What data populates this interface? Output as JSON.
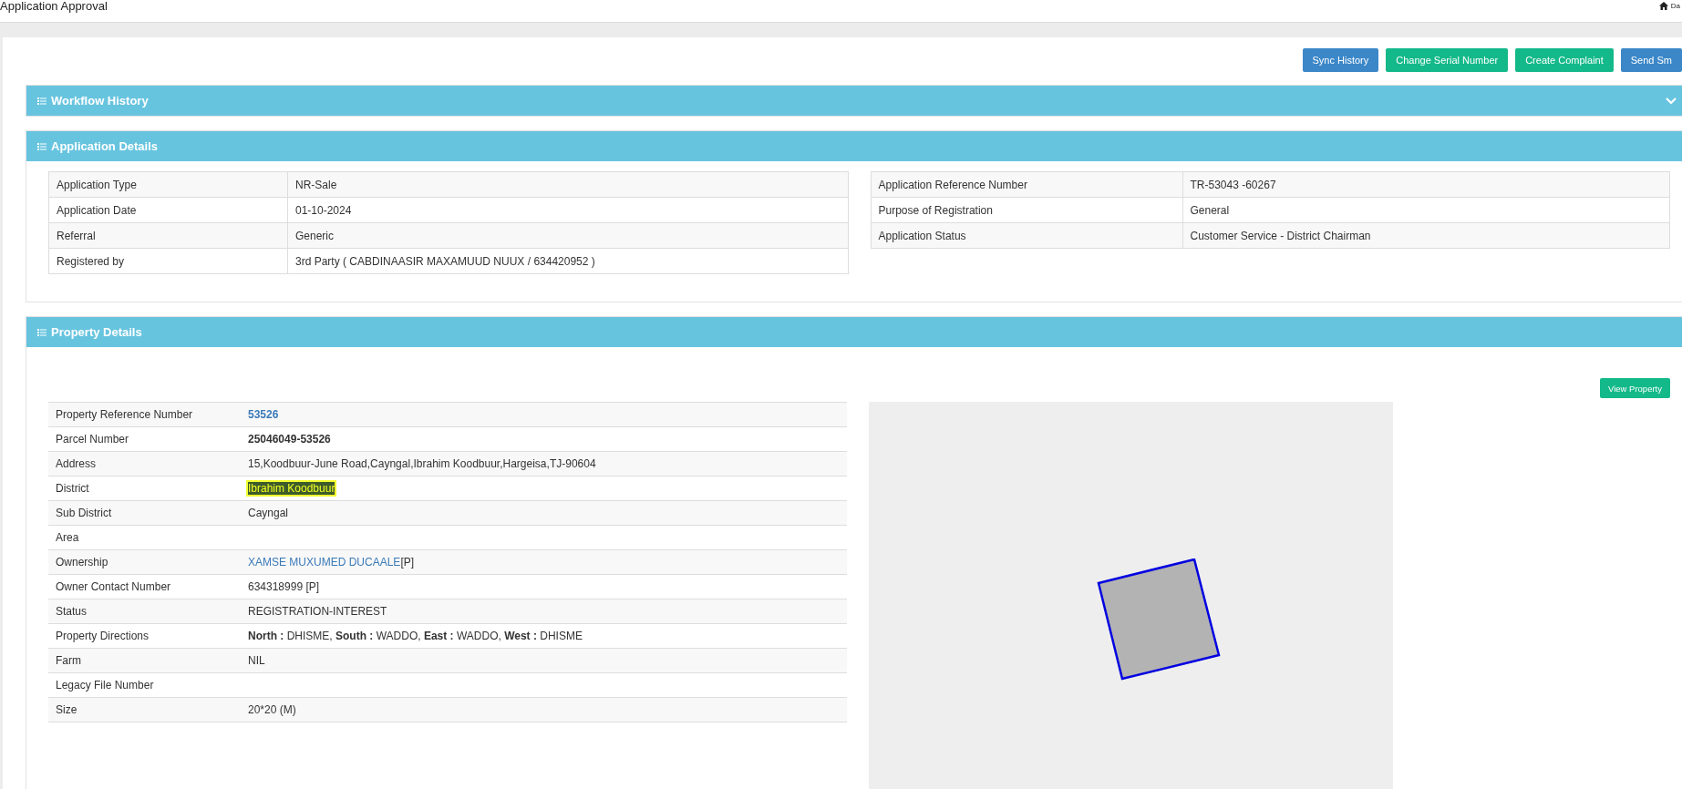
{
  "header": {
    "title": "Application Approval",
    "user": "Da"
  },
  "actions": [
    {
      "label": "Sync History",
      "kind": "primary"
    },
    {
      "label": "Change Serial Number",
      "kind": "success"
    },
    {
      "label": "Create Complaint",
      "kind": "success"
    },
    {
      "label": "Send Sm",
      "kind": "primary"
    }
  ],
  "workflow_history": {
    "title": "Workflow History",
    "expanded": false
  },
  "application_details": {
    "title": "Application Details",
    "left": [
      {
        "label": "Application Type",
        "value": "NR-Sale"
      },
      {
        "label": "Application Date",
        "value": "01-10-2024"
      },
      {
        "label": "Referral",
        "value": "Generic"
      },
      {
        "label": "Registered by",
        "value": "3rd Party ( CABDINAASIR MAXAMUUD NUUX / 634420952 )"
      }
    ],
    "right": [
      {
        "label": "Application Reference Number",
        "value": "TR-53043 -60267"
      },
      {
        "label": "Purpose of Registration",
        "value": "General"
      },
      {
        "label": "Application Status",
        "value": "Customer Service - District Chairman"
      }
    ]
  },
  "property_details": {
    "title": "Property Details",
    "view_button": "View Property",
    "rows": [
      {
        "label": "Property Reference Number",
        "value": "53526",
        "kind": "link",
        "highlighted": false
      },
      {
        "label": "Parcel Number",
        "value": "25046049-53526",
        "kind": "bold",
        "highlighted": false
      },
      {
        "label": "Address",
        "value": "15,Koodbuur-June Road,Cayngal,Ibrahim Koodbuur,Hargeisa,TJ-90604",
        "kind": "text",
        "highlighted": false
      },
      {
        "label": "District",
        "value": "Ibrahim Koodbuur",
        "kind": "text",
        "highlighted": true
      },
      {
        "label": "Sub District",
        "value": "Cayngal",
        "kind": "text",
        "highlighted": false
      },
      {
        "label": "Area",
        "kind": "text",
        "highlighted": false
      },
      {
        "label": "Ownership",
        "value": "XAMSE MUXUMED DUCAALE",
        "suffix": "[P]",
        "kind": "link",
        "highlighted": false
      },
      {
        "label": "Owner Contact Number",
        "value": "634318999 [P]",
        "kind": "text",
        "highlighted": false
      },
      {
        "label": "Status",
        "value": "REGISTRATION-INTEREST",
        "kind": "text",
        "highlighted": false
      },
      {
        "label": "Property Directions",
        "value": "**North :** DHISME, **South :** WADDO, **East :** WADDO, **West :** DHISME",
        "kind": "rich",
        "highlighted": false
      },
      {
        "label": "Farm",
        "value": "NIL",
        "kind": "text",
        "highlighted": false
      },
      {
        "label": "Legacy File Number",
        "kind": "text",
        "highlighted": false
      },
      {
        "label": "Size",
        "value": "20*20 (M)",
        "kind": "text",
        "highlighted": false
      }
    ]
  }
}
